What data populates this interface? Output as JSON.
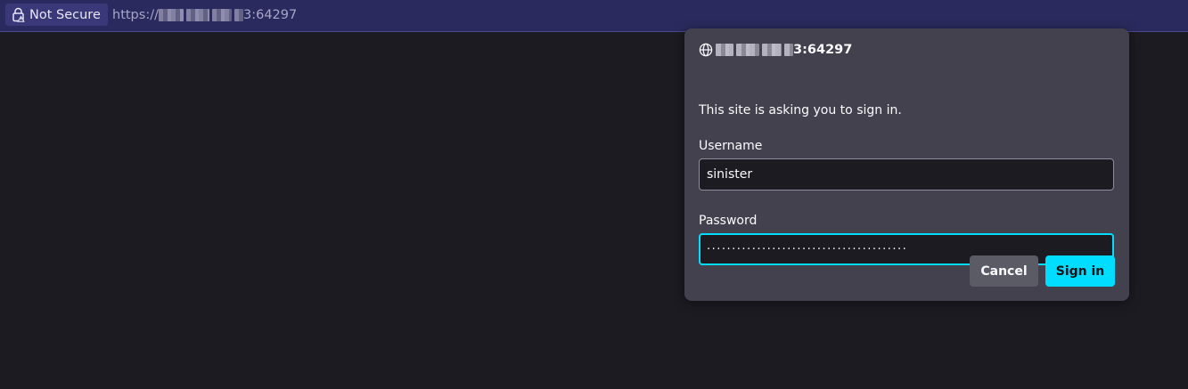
{
  "urlbar": {
    "security_label": "Not Secure",
    "security_icon": "lock-warning-icon",
    "url_prefix": "https://",
    "url_suffix": "3:64297"
  },
  "dialog": {
    "origin_icon": "globe-icon",
    "origin_suffix": "3:64297",
    "message": "This site is asking you to sign in.",
    "username_label": "Username",
    "username_value": "sinister",
    "password_label": "Password",
    "password_value": "········································",
    "cancel_label": "Cancel",
    "signin_label": "Sign in"
  },
  "colors": {
    "accent": "#00ddff",
    "urlbar_bg": "#2b2a5e",
    "dialog_bg": "#42414d",
    "page_bg": "#1c1b22"
  }
}
